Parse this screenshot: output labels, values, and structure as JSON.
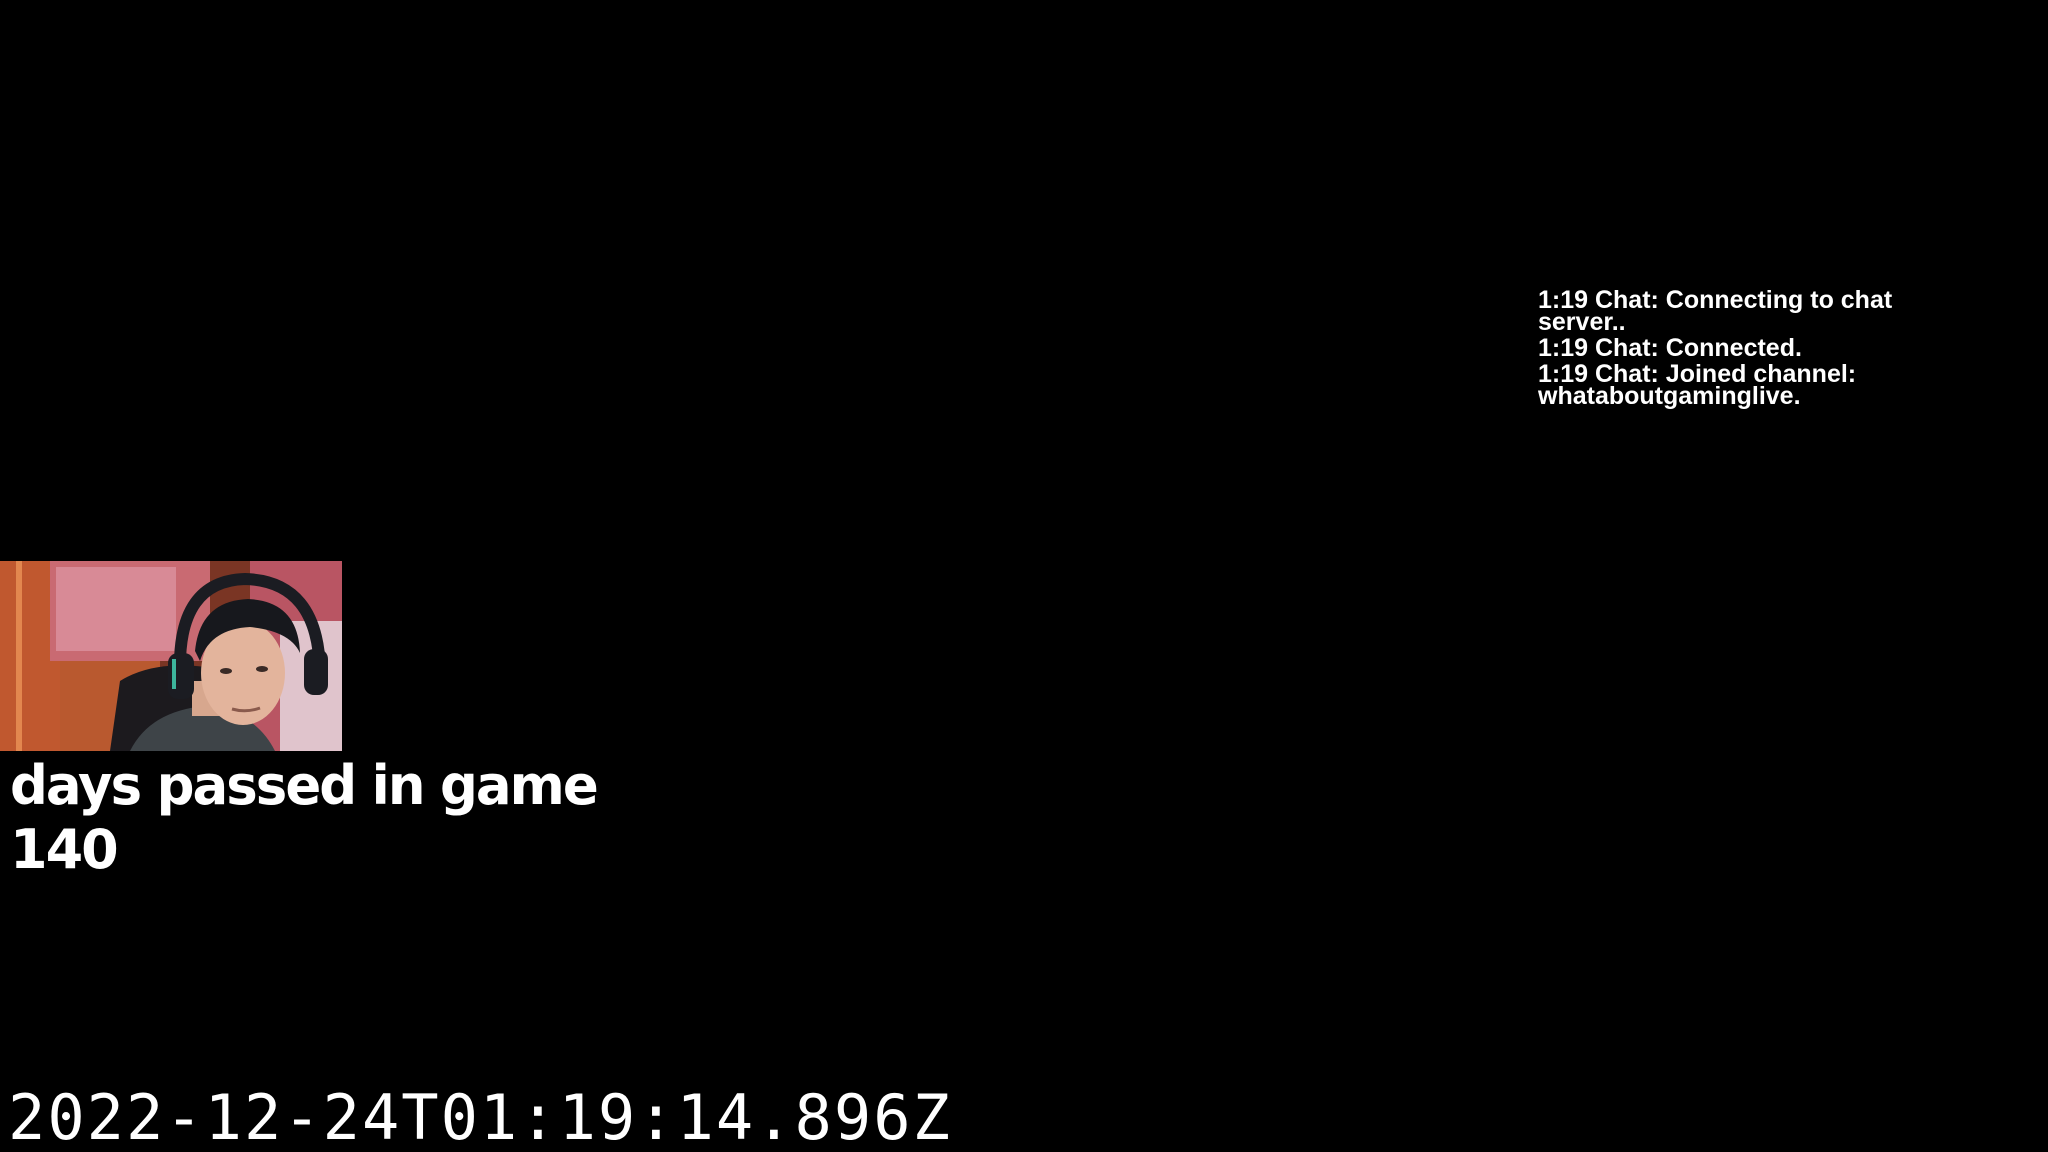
{
  "chat": {
    "lines": [
      "1:19 Chat: Connecting to chat server..",
      "1:19 Chat: Connected.",
      "1:19 Chat: Joined channel: whataboutgaminglive."
    ]
  },
  "overlay": {
    "days_label": "days passed in game",
    "days_value": "140"
  },
  "timestamp": "2022-12-24T01:19:14.896Z",
  "colors": {
    "background": "#000000",
    "text": "#ffffff"
  }
}
